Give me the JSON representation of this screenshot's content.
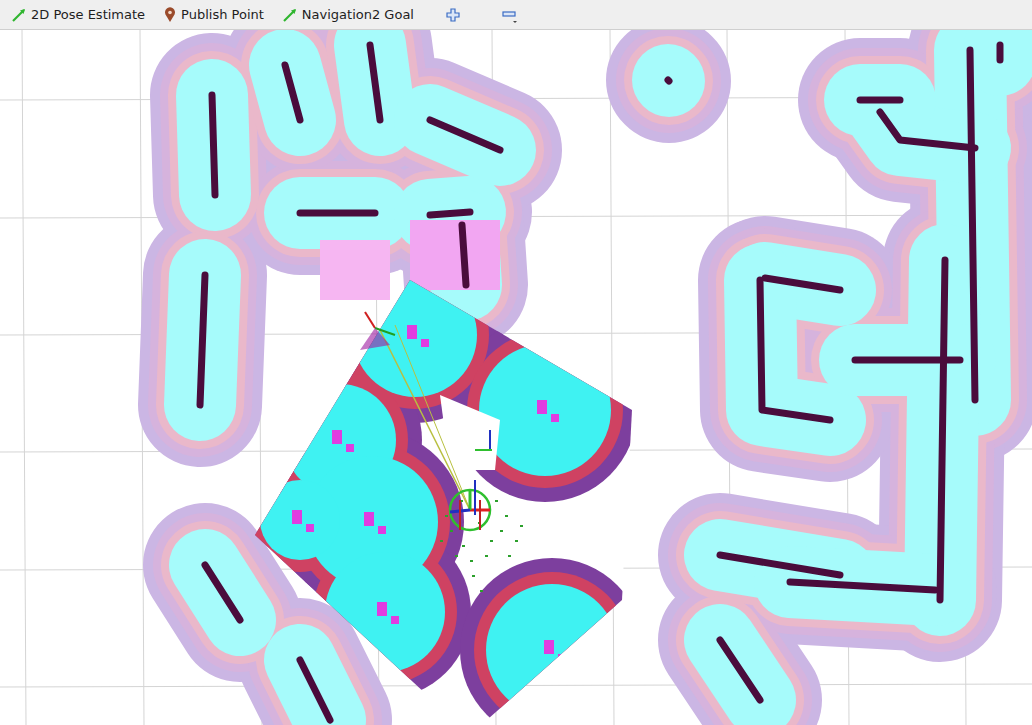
{
  "toolbar": {
    "tools": [
      {
        "label": "2D Pose Estimate",
        "selected": false
      },
      {
        "label": "Publish Point",
        "selected": false
      },
      {
        "label": "Navigation2 Goal",
        "selected": false
      }
    ]
  }
}
